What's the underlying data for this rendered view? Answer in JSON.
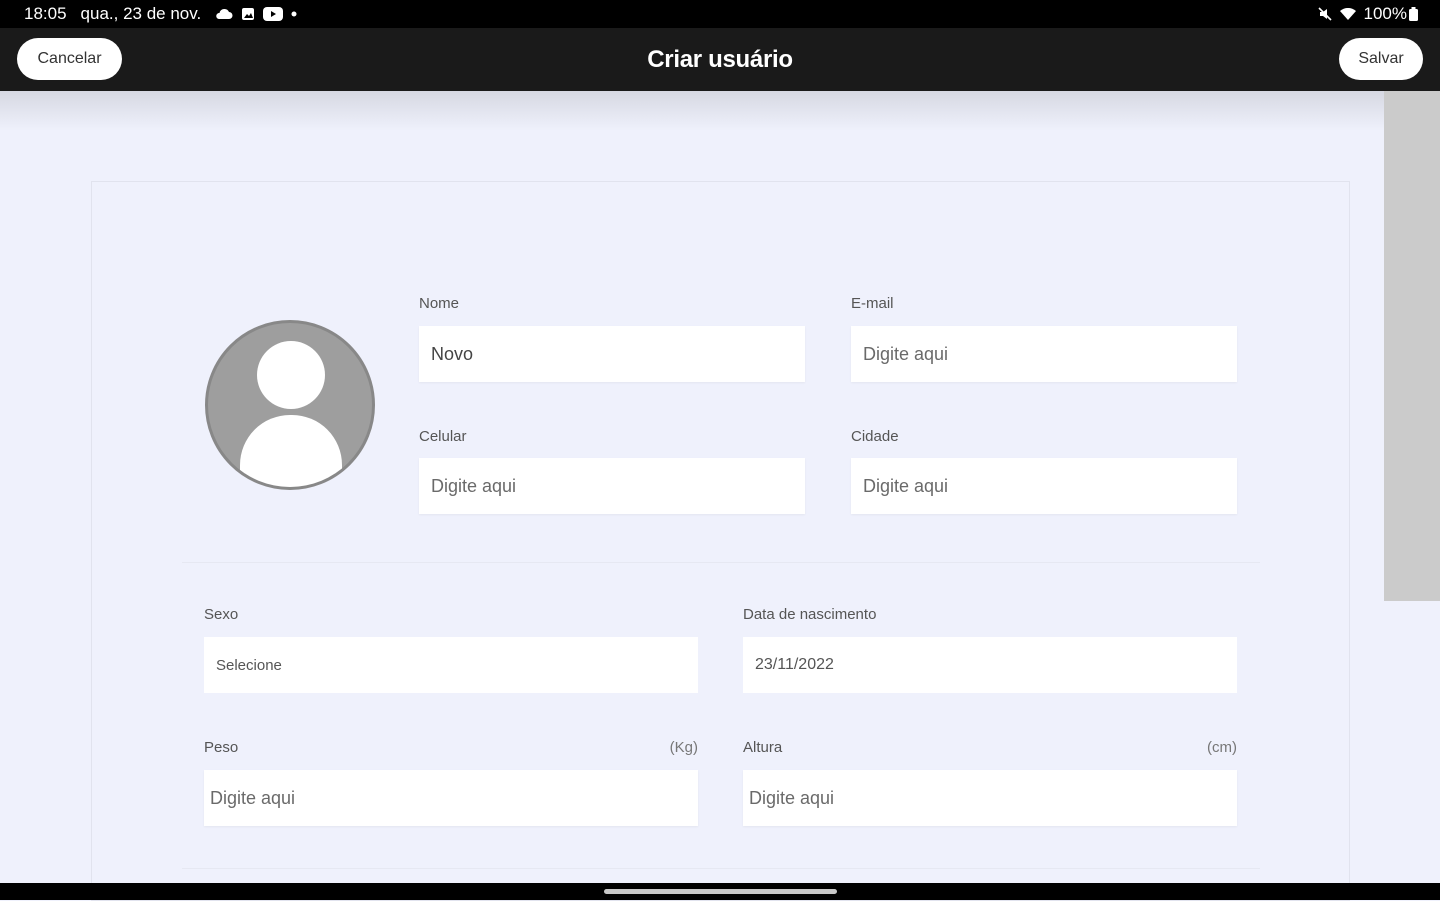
{
  "statusbar": {
    "time": "18:05",
    "date": "qua., 23 de nov.",
    "battery": "100%",
    "left_icons": [
      "cloud-icon",
      "image-icon",
      "youtube-icon",
      "dot-icon"
    ],
    "right_icons": [
      "mute-icon",
      "wifi-icon",
      "battery-icon"
    ]
  },
  "appbar": {
    "title": "Criar usuário",
    "cancel_label": "Cancelar",
    "save_label": "Salvar"
  },
  "form": {
    "nome": {
      "label": "Nome",
      "value": "Novo"
    },
    "email": {
      "label": "E-mail",
      "placeholder": "Digite aqui"
    },
    "celular": {
      "label": "Celular",
      "placeholder": "Digite aqui"
    },
    "cidade": {
      "label": "Cidade",
      "placeholder": "Digite aqui"
    },
    "sexo": {
      "label": "Sexo",
      "value": "Selecione"
    },
    "nascimento": {
      "label": "Data de nascimento",
      "value": "23/11/2022"
    },
    "peso": {
      "label": "Peso",
      "unit": "(Kg)",
      "placeholder": "Digite aqui"
    },
    "altura": {
      "label": "Altura",
      "unit": "(cm)",
      "placeholder": "Digite aqui"
    }
  },
  "colors": {
    "appbar": "#1a1a1a",
    "background": "#eff1fc",
    "avatar": "#9e9e9e"
  }
}
